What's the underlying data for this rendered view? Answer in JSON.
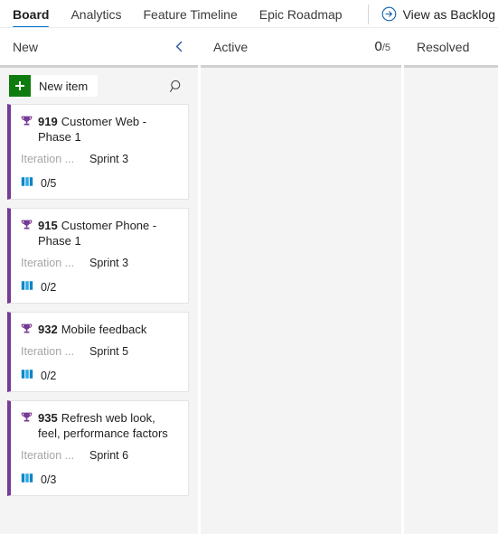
{
  "topnav": {
    "tabs": [
      {
        "label": "Board",
        "active": true
      },
      {
        "label": "Analytics",
        "active": false
      },
      {
        "label": "Feature Timeline",
        "active": false
      },
      {
        "label": "Epic Roadmap",
        "active": false
      }
    ],
    "action": {
      "icon": "arrow-circle-right-icon",
      "label": "View as Backlog"
    }
  },
  "board": {
    "columns": [
      {
        "name": "new",
        "title": "New",
        "collapse_icon": "chevron-left-icon",
        "wip": null,
        "toolbar": {
          "new_item_label": "New item",
          "new_item_icon": "plus-icon",
          "search_icon": "search-icon"
        },
        "cards": [
          {
            "type_icon": "trophy-icon",
            "id": "919",
            "title": "Customer Web - Phase 1",
            "field_label": "Iteration ...",
            "field_value": "Sprint 3",
            "progress_icon": "progress-bars-icon",
            "progress": "0/5"
          },
          {
            "type_icon": "trophy-icon",
            "id": "915",
            "title": "Customer Phone - Phase 1",
            "field_label": "Iteration ...",
            "field_value": "Sprint 3",
            "progress_icon": "progress-bars-icon",
            "progress": "0/2"
          },
          {
            "type_icon": "trophy-icon",
            "id": "932",
            "title": "Mobile feedback",
            "field_label": "Iteration ...",
            "field_value": "Sprint 5",
            "progress_icon": "progress-bars-icon",
            "progress": "0/2"
          },
          {
            "type_icon": "trophy-icon",
            "id": "935",
            "title": "Refresh web look, feel, performance factors",
            "field_label": "Iteration ...",
            "field_value": "Sprint 6",
            "progress_icon": "progress-bars-icon",
            "progress": "0/3"
          }
        ]
      },
      {
        "name": "active",
        "title": "Active",
        "wip_current": "0",
        "wip_limit": "/5",
        "cards": []
      },
      {
        "name": "resolved",
        "title": "Resolved",
        "wip": null,
        "cards": []
      }
    ]
  },
  "colors": {
    "accent": "#0078d4",
    "epic_purple": "#773b93",
    "new_item_green": "#107c10",
    "progress_blue": "#0078d4",
    "column_bg": "#f4f4f4"
  }
}
